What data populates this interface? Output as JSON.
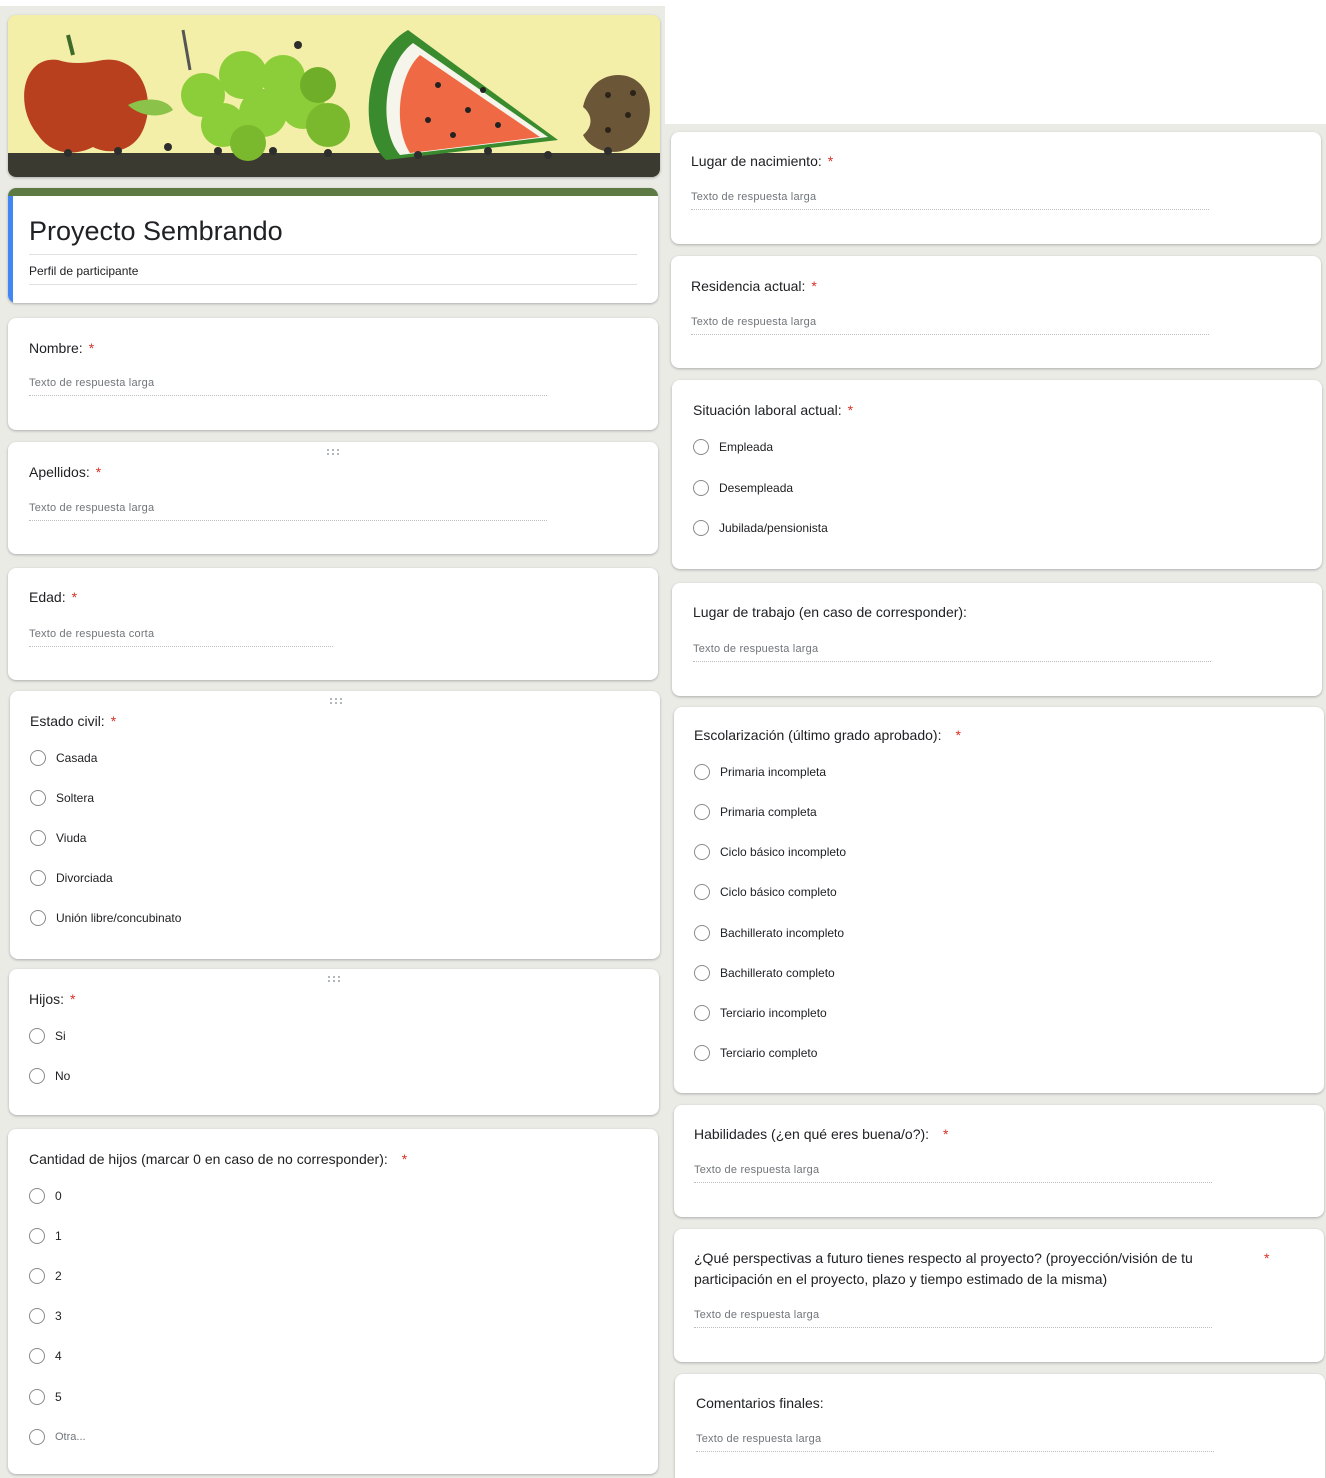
{
  "form": {
    "title": "Proyecto Sembrando",
    "description": "Perfil de participante",
    "accent_color": "#4285f4",
    "top_bar_color": "#5d7a44"
  },
  "required_mark": "*",
  "placeholders": {
    "long": "Texto de respuesta larga",
    "short": "Texto de respuesta corta",
    "other": "Otra..."
  },
  "questions": {
    "nombre": {
      "title": "Nombre:"
    },
    "apellidos": {
      "title": "Apellidos:"
    },
    "edad": {
      "title": "Edad:"
    },
    "estado_civil": {
      "title": "Estado civil:",
      "options": [
        "Casada",
        "Soltera",
        "Viuda",
        "Divorciada",
        "Unión libre/concubinato"
      ]
    },
    "hijos": {
      "title": "Hijos:",
      "options": [
        "Si",
        "No"
      ]
    },
    "cantidad_hijos": {
      "title": "Cantidad de hijos (marcar 0 en caso de no corresponder):",
      "options": [
        "0",
        "1",
        "2",
        "3",
        "4",
        "5"
      ]
    },
    "lugar_nacimiento": {
      "title": "Lugar de nacimiento:"
    },
    "residencia": {
      "title": "Residencia actual:"
    },
    "situacion_laboral": {
      "title": "Situación laboral actual:",
      "options": [
        "Empleada",
        "Desempleada",
        "Jubilada/pensionista"
      ]
    },
    "lugar_trabajo": {
      "title": "Lugar de trabajo (en caso de corresponder):"
    },
    "escolarizacion": {
      "title": "Escolarización (último grado aprobado):",
      "options": [
        "Primaria incompleta",
        "Primaria completa",
        "Ciclo básico incompleto",
        "Ciclo básico completo",
        "Bachillerato incompleto",
        "Bachillerato completo",
        "Terciario incompleto",
        "Terciario completo"
      ]
    },
    "habilidades": {
      "title": "Habilidades (¿en qué eres buena/o?):"
    },
    "perspectivas": {
      "title": "¿Qué perspectivas a futuro tienes respecto al proyecto? (proyección/visión de tu participación en el proyecto, plazo y tiempo estimado de la misma)"
    },
    "comentarios": {
      "title": "Comentarios finales:"
    }
  }
}
